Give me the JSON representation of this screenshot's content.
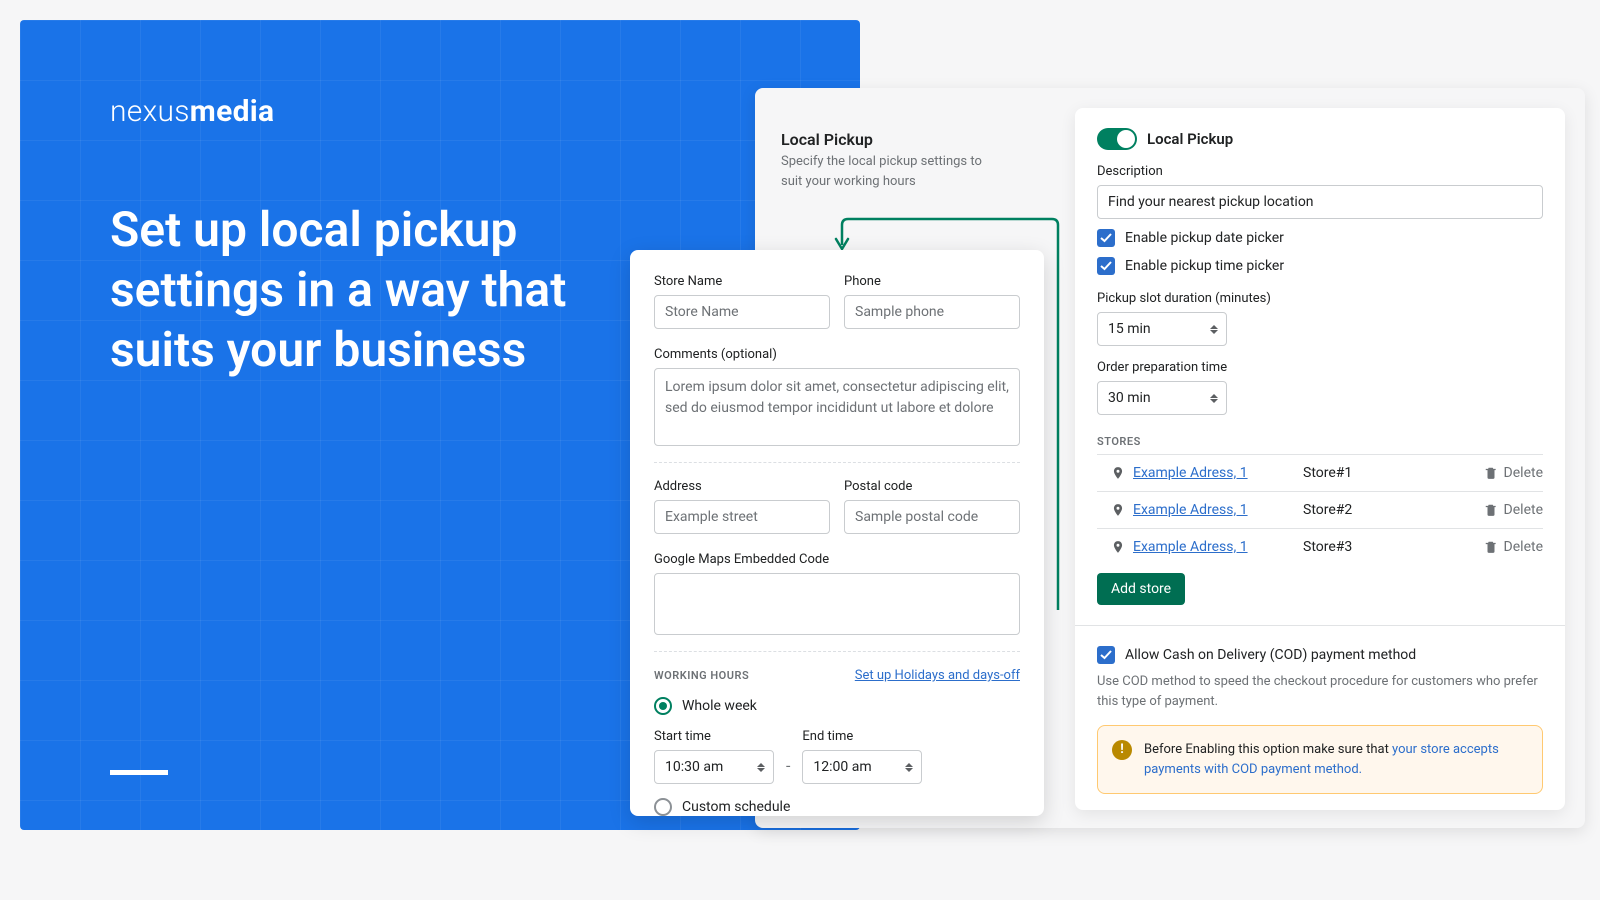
{
  "brand": {
    "light": "nexus",
    "bold": "media"
  },
  "headline": "Set up local pickup settings in a way that suits your business",
  "bg": {
    "title": "Local Pickup",
    "sub": "Specify the local pickup settings to suit your working hours"
  },
  "store": {
    "storeNameLabel": "Store Name",
    "storeNamePh": "Store Name",
    "phoneLabel": "Phone",
    "phonePh": "Sample phone",
    "commentsLabel": "Comments (optional)",
    "commentsPh": "Lorem ipsum dolor sit amet, consectetur adipiscing elit, sed do eiusmod tempor incididunt ut labore et dolore",
    "addressLabel": "Address",
    "addressPh": "Example street",
    "postalLabel": "Postal code",
    "postalPh": "Sample postal code",
    "mapsLabel": "Google Maps Embedded Code",
    "hoursSection": "WORKING HOURS",
    "holidaysLink": "Set up Holidays and days-off",
    "wholeWeek": "Whole week",
    "customSchedule": "Custom schedule",
    "startLabel": "Start time",
    "start": "10:30 am",
    "endLabel": "End time",
    "end": "12:00 am",
    "dash": "-"
  },
  "right": {
    "title": "Local Pickup",
    "descLabel": "Description",
    "descVal": "Find your nearest pickup location",
    "enableDate": "Enable pickup date picker",
    "enableTime": "Enable pickup time picker",
    "slotLabel": "Pickup slot duration (minutes)",
    "slot": "15 min",
    "prepLabel": "Order preparation time",
    "prep": "30 min",
    "storesSection": "STORES",
    "stores": [
      {
        "addr": "Example Adress, 1",
        "name": "Store#1"
      },
      {
        "addr": "Example Adress, 1",
        "name": "Store#2"
      },
      {
        "addr": "Example Adress, 1",
        "name": "Store#3"
      }
    ],
    "delete": "Delete",
    "addStore": "Add store",
    "cod": "Allow Cash on Delivery (COD) payment method",
    "codHelp": "Use COD method to speed the checkout procedure for customers who prefer this type of payment.",
    "banner1": "Before Enabling this option make sure that ",
    "bannerLink": "your store accepts payments with COD payment method."
  }
}
